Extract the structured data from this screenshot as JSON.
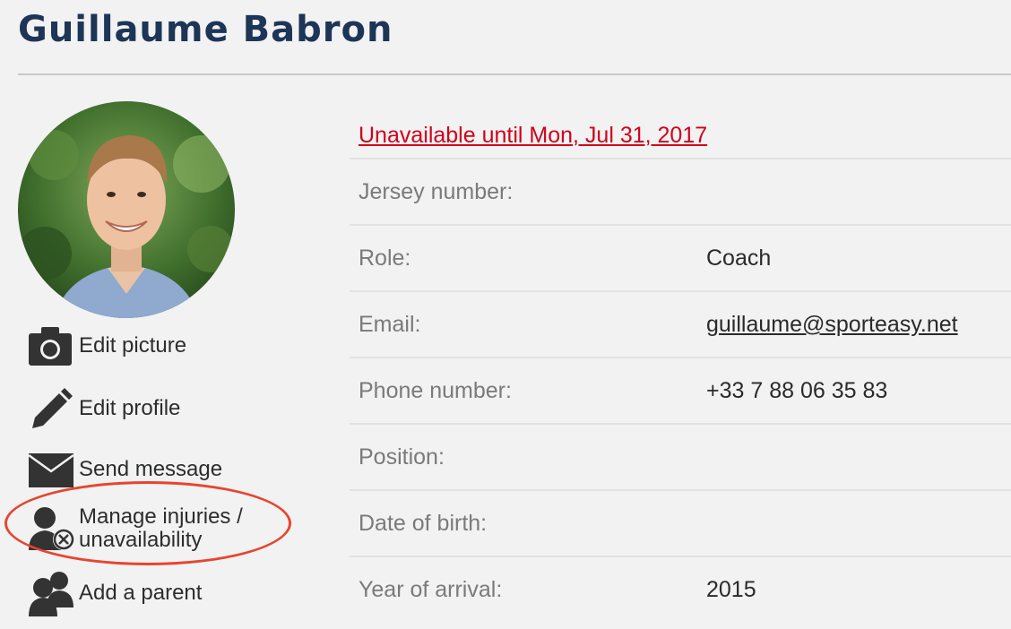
{
  "profile": {
    "name": "Guillaume Babron",
    "status": "Unavailable until Mon, Jul 31, 2017"
  },
  "actions": [
    {
      "label": "Edit picture",
      "icon": "camera-icon"
    },
    {
      "label": "Edit profile",
      "icon": "pencil-icon"
    },
    {
      "label": "Send message",
      "icon": "envelope-icon"
    },
    {
      "label_line1": "Manage injuries /",
      "label_line2": "unavailability",
      "icon": "user-unavailable-icon"
    },
    {
      "label": "Add a parent",
      "icon": "users-icon"
    }
  ],
  "details": {
    "jersey": {
      "label": "Jersey number:",
      "value": ""
    },
    "role": {
      "label": "Role:",
      "value": "Coach"
    },
    "email": {
      "label": "Email:",
      "value": "guillaume@sporteasy.net"
    },
    "phone": {
      "label": "Phone number:",
      "value": "+33 7 88 06 35 83"
    },
    "position": {
      "label": "Position:",
      "value": ""
    },
    "birth": {
      "label": "Date of birth:",
      "value": ""
    },
    "arrival": {
      "label": "Year of arrival:",
      "value": "2015"
    }
  },
  "colors": {
    "title": "#1d3557",
    "status": "#d0021b",
    "highlight": "#e8442f",
    "background": "#f2f2f2"
  }
}
